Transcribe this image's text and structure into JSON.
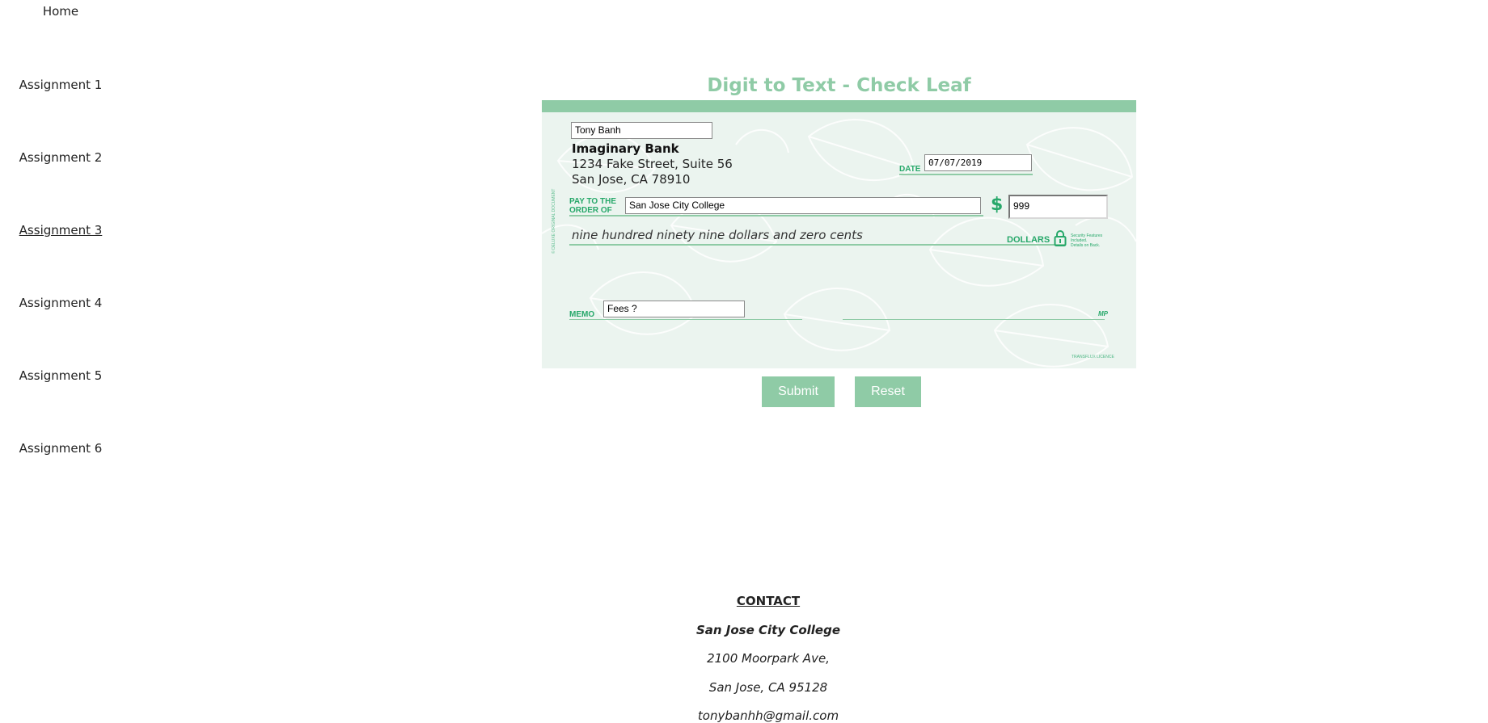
{
  "nav": {
    "items": [
      {
        "label": "Home"
      },
      {
        "label": "Assignment 1"
      },
      {
        "label": "Assignment 2"
      },
      {
        "label": "Assignment 3"
      },
      {
        "label": "Assignment 4"
      },
      {
        "label": "Assignment 5"
      },
      {
        "label": "Assignment 6"
      }
    ],
    "active": "Assignment 3"
  },
  "page": {
    "title": "Digit to Text - Check Leaf"
  },
  "check": {
    "name_value": "Tony Banh",
    "bank_name": "Imaginary Bank",
    "bank_address_line1": "1234 Fake Street, Suite 56",
    "bank_address_line2": "San Jose, CA 78910",
    "date_label": "DATE",
    "date_value": "07/07/2019",
    "pay_to_line1": "PAY TO THE",
    "pay_to_line2": "ORDER OF",
    "payee_value": "San Jose City College",
    "dollar_sign": "$",
    "amount_value": "999",
    "amount_words": "nine hundred ninety nine dollars and zero cents",
    "dollars_label": "DOLLARS",
    "security_line1": "Security Features",
    "security_line2": "Included.",
    "security_line3": "Details on Back.",
    "memo_label": "MEMO",
    "memo_value": "Fees ?",
    "signature_mark": "MP",
    "side_text": "© DELUXE  ORIGINAL DOCUMENT",
    "footer_text": "TRANSFLUX LICENCE"
  },
  "buttons": {
    "submit_label": "Submit",
    "reset_label": "Reset"
  },
  "contact": {
    "heading": "CONTACT",
    "college": "San Jose City College",
    "address1": "2100 Moorpark Ave,",
    "address2": "San Jose, CA 95128",
    "email": "tonybanhh@gmail.com"
  },
  "colors": {
    "accent": "#8fcba6",
    "check_bg": "#ebf4ef",
    "check_green": "#27a86a"
  }
}
